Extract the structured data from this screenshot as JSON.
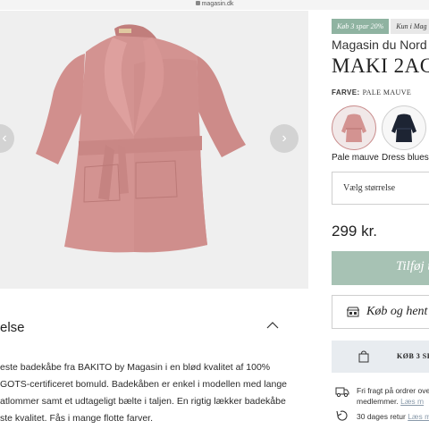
{
  "browser": {
    "url": "magasin.dk"
  },
  "gallery": {
    "prev_icon": "chevron-left-icon",
    "next_icon": "chevron-right-icon"
  },
  "description": {
    "title": "else",
    "lines": [
      "este badekåbe fra BAKITO by Magasin i en blød kvalitet af 100%",
      "GOTS-certificeret bomuld. Badekåben er enkel i modellen med lange",
      "atlommer samt et udtageligt bælte i taljen. En rigtig lækker badekåbe",
      "ste kvalitet. Fås i mange flotte farver."
    ]
  },
  "product": {
    "badges": [
      "Køb 3 spar 20%",
      "Kun i Mag"
    ],
    "brand": "Magasin du Nord",
    "title": "MAKI 2AG",
    "color_label": "FARVE:",
    "color_value": "PALE MAUVE",
    "colors": [
      {
        "name": "Pale mauve",
        "hex": "#c98c8c",
        "selected": true
      },
      {
        "name": "Dress blues",
        "hex": "#1d2433",
        "selected": false
      }
    ],
    "size_placeholder": "Vælg størrelse",
    "price": "299 kr.",
    "add_to_cart": "Tilføj ti",
    "member_button": "Køb og hent i",
    "offer": "KØB 3 SP",
    "usps": [
      {
        "icon": "truck-icon",
        "line1": "Fri fragt på ordrer ove",
        "line2_text": "medlemmer.",
        "line2_link": "Læs m"
      },
      {
        "icon": "return-icon",
        "line1": "30 dages retur",
        "link": "Læs m"
      }
    ]
  },
  "colors": {
    "accent_green": "#a7c2b4",
    "badge_green": "#8fb3a1",
    "robe_pink": "#d08e8b"
  }
}
